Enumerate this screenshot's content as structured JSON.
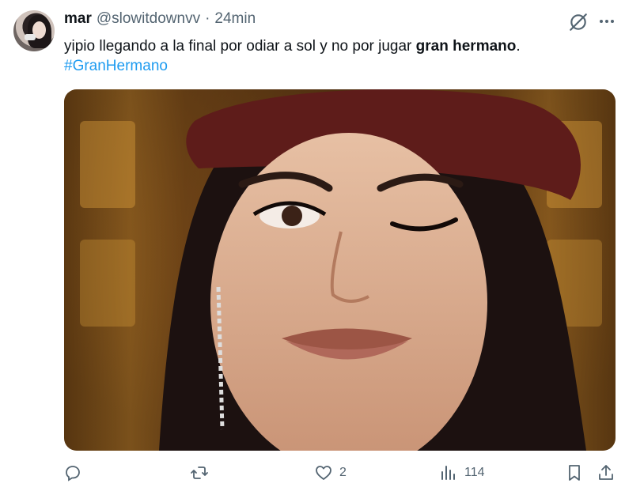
{
  "tweet": {
    "display_name": "mar",
    "handle": "@slowitdownvv",
    "separator": "·",
    "timestamp": "24min",
    "text_plain": "yipio llegando a la final por odiar a sol y no por jugar ",
    "text_bold": "gran hermano",
    "text_end": ".",
    "hashtag": "#GranHermano"
  },
  "stats": {
    "replies": "",
    "reposts": "",
    "likes": "2",
    "views": "114"
  },
  "icons": {
    "header": [
      "grok-icon",
      "more-icon"
    ],
    "actions": [
      "reply-icon",
      "repost-icon",
      "like-icon",
      "views-icon",
      "bookmark-icon",
      "share-icon"
    ]
  },
  "colors": {
    "text": "#0f1419",
    "secondary": "#536471",
    "link": "#1d9bf0"
  }
}
